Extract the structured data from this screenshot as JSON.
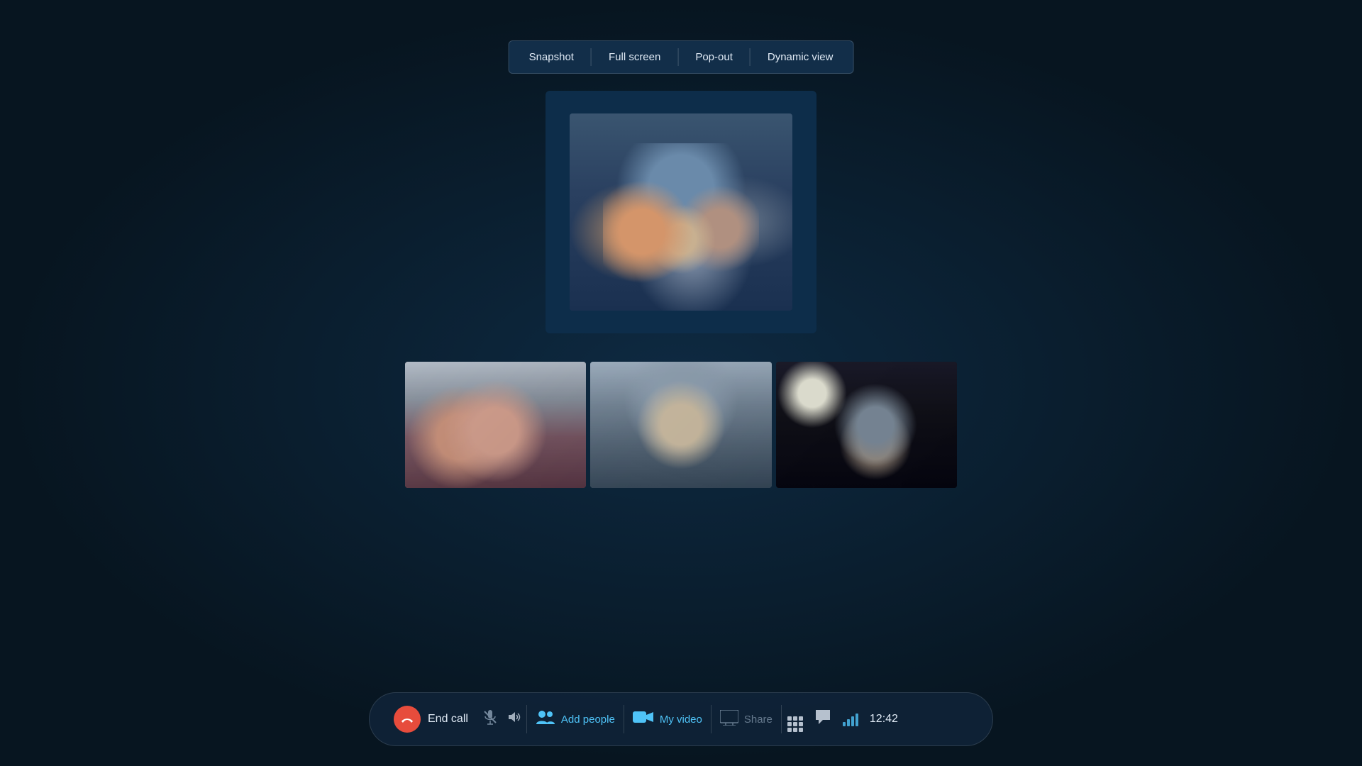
{
  "toolbar": {
    "snapshot_label": "Snapshot",
    "fullscreen_label": "Full screen",
    "popout_label": "Pop-out",
    "dynamicview_label": "Dynamic view"
  },
  "callbar": {
    "endcall_label": "End call",
    "addpeople_label": "Add people",
    "myvideo_label": "My video",
    "share_label": "Share",
    "time": "12:42"
  },
  "icons": {
    "phone_end": "📵",
    "mic_muted": "🎤",
    "volume": "🔊",
    "add_people": "👥",
    "video": "📹",
    "share_screen": "🖥",
    "grid": "⊞",
    "chat": "💬",
    "signal": "📶"
  }
}
